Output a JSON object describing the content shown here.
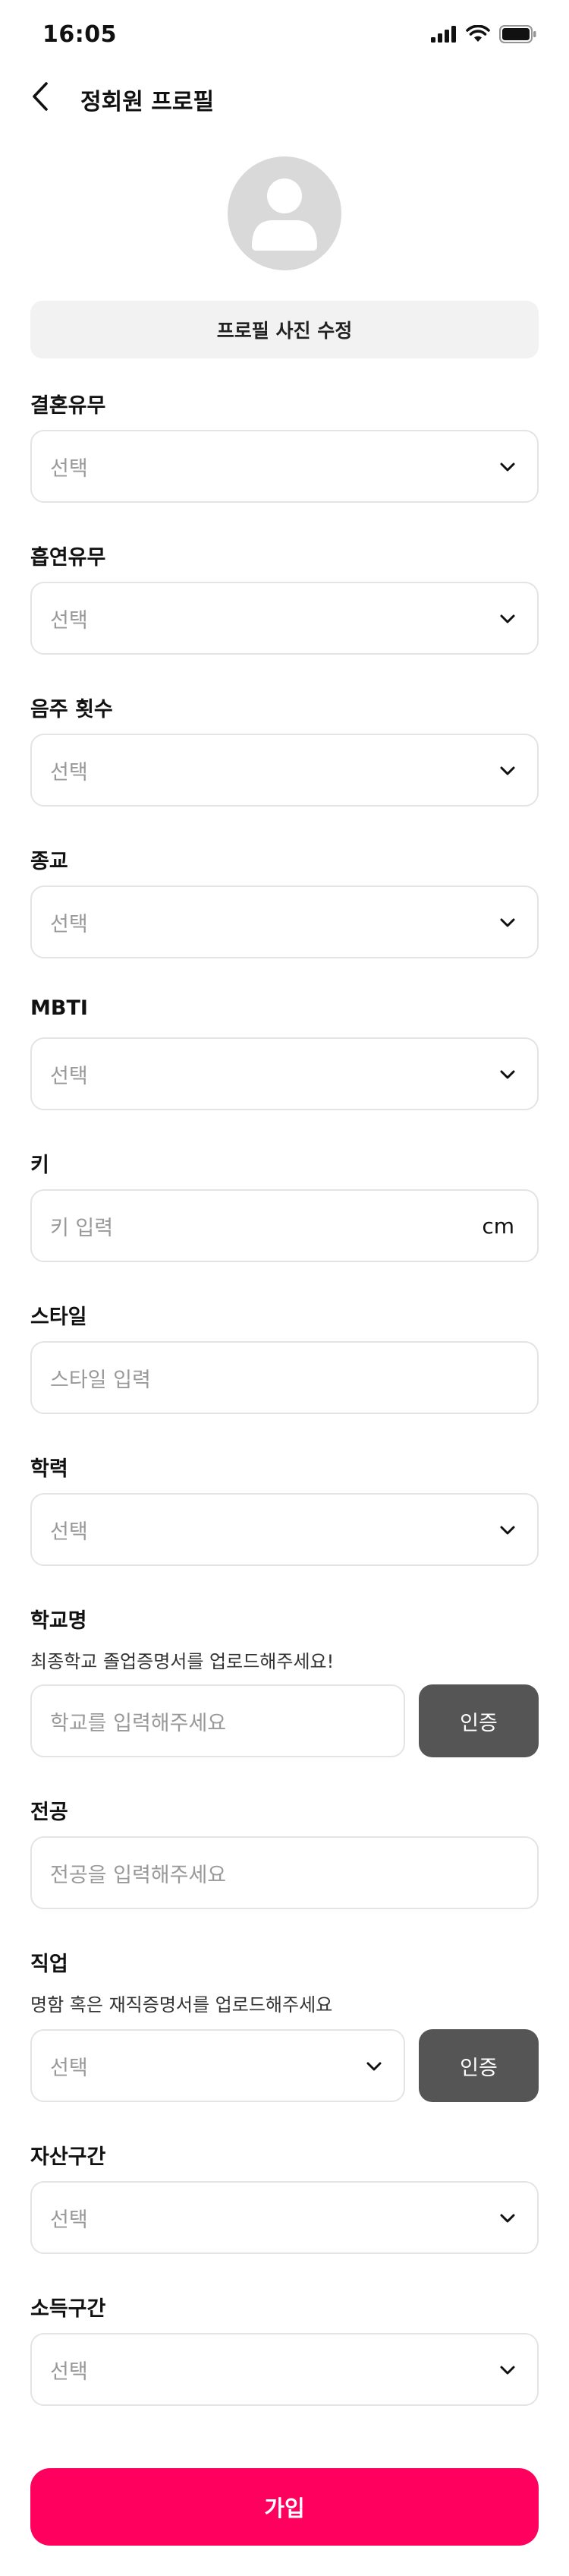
{
  "status_bar": {
    "time": "16:05"
  },
  "header": {
    "title": "정회원 프로필"
  },
  "profile": {
    "photo_button_label": "프로필 사진 수정"
  },
  "fields": {
    "marriage": {
      "label": "결혼유무",
      "value": "선택"
    },
    "smoking": {
      "label": "흡연유무",
      "value": "선택"
    },
    "drinking": {
      "label": "음주 횟수",
      "value": "선택"
    },
    "religion": {
      "label": "종교",
      "value": "선택"
    },
    "mbti": {
      "label": "MBTI",
      "value": "선택"
    },
    "height": {
      "label": "키",
      "placeholder": "키 입력",
      "unit": "cm"
    },
    "style": {
      "label": "스타일",
      "placeholder": "스타일 입력"
    },
    "education": {
      "label": "학력",
      "value": "선택"
    },
    "school": {
      "label": "학교명",
      "help": "최종학교 졸업증명서를 업로드해주세요!",
      "placeholder": "학교를 입력해주세요",
      "verify_label": "인증"
    },
    "major": {
      "label": "전공",
      "placeholder": "전공을 입력해주세요"
    },
    "job": {
      "label": "직업",
      "help": "명함 혹은 재직증명서를 업로드해주세요",
      "value": "선택",
      "verify_label": "인증"
    },
    "assets": {
      "label": "자산구간",
      "value": "선택"
    },
    "income": {
      "label": "소득구간",
      "value": "선택"
    }
  },
  "submit": {
    "label": "가입"
  },
  "colors": {
    "accent": "#ff005f",
    "verify_button": "#555555",
    "placeholder": "#999999",
    "border": "#e4e4e4"
  }
}
